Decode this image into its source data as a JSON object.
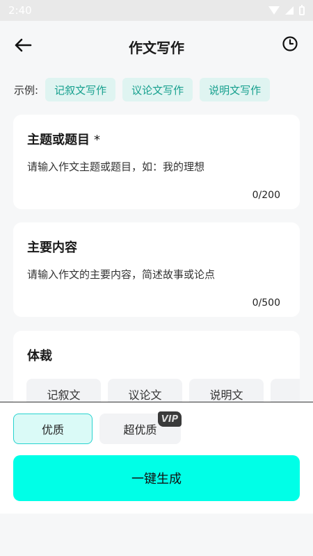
{
  "status_bar": {
    "time": "2:40"
  },
  "header": {
    "title": "作文写作"
  },
  "examples": {
    "label": "示例:",
    "chips": [
      "记叙文写作",
      "议论文写作",
      "说明文写作"
    ]
  },
  "topic_card": {
    "title": "主题或题目",
    "required_mark": "*",
    "placeholder": "请输入作文主题或题目，如：我的理想",
    "counter": "0/200"
  },
  "content_card": {
    "title": "主要内容",
    "placeholder": "请输入作文的主要内容，简述故事或论点",
    "counter": "0/500"
  },
  "genre_card": {
    "title": "体裁",
    "options": [
      "记叙文",
      "议论文",
      "说明文"
    ]
  },
  "quality": {
    "options": [
      "优质",
      "超优质"
    ],
    "vip_badge": "VIP",
    "selected": "优质"
  },
  "generate_button": {
    "label": "一键生成"
  },
  "colors": {
    "accent": "#00ffe7",
    "chip_text": "#16a08e",
    "chip_bg": "#dff4f1"
  }
}
